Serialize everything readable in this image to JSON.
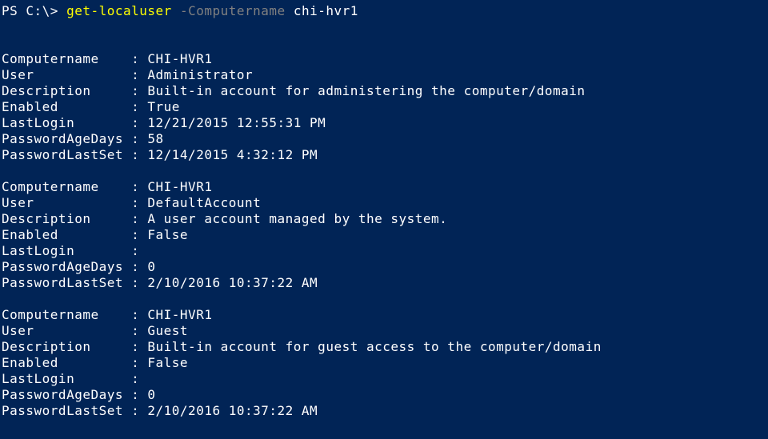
{
  "prompt": {
    "prefix": "PS C:\\> ",
    "cmdlet": "get-localuser",
    "space1": " ",
    "param": "-Computername",
    "space2": " ",
    "arg": "chi-hvr1"
  },
  "fields": [
    "Computername",
    "User",
    "Description",
    "Enabled",
    "LastLogin",
    "PasswordAgeDays",
    "PasswordLastSet"
  ],
  "entries": [
    {
      "Computername": "CHI-HVR1",
      "User": "Administrator",
      "Description": "Built-in account for administering the computer/domain",
      "Enabled": "True",
      "LastLogin": "12/21/2015 12:55:31 PM",
      "PasswordAgeDays": "58",
      "PasswordLastSet": "12/14/2015 4:32:12 PM"
    },
    {
      "Computername": "CHI-HVR1",
      "User": "DefaultAccount",
      "Description": "A user account managed by the system.",
      "Enabled": "False",
      "LastLogin": "",
      "PasswordAgeDays": "0",
      "PasswordLastSet": "2/10/2016 10:37:22 AM"
    },
    {
      "Computername": "CHI-HVR1",
      "User": "Guest",
      "Description": "Built-in account for guest access to the computer/domain",
      "Enabled": "False",
      "LastLogin": "",
      "PasswordAgeDays": "0",
      "PasswordLastSet": "2/10/2016 10:37:22 AM"
    }
  ]
}
